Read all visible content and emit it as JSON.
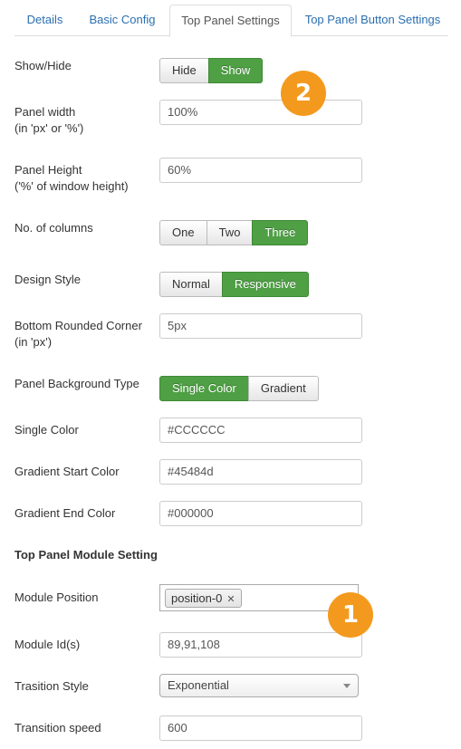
{
  "tabs": [
    {
      "label": "Details"
    },
    {
      "label": "Basic Config"
    },
    {
      "label": "Top Panel Settings",
      "active": true
    },
    {
      "label": "Top Panel Button Settings"
    }
  ],
  "fields": {
    "show_hide": {
      "label": "Show/Hide",
      "options": [
        "Hide",
        "Show"
      ],
      "selected": "Show"
    },
    "panel_width": {
      "label": "Panel width",
      "sublabel": "(in 'px' or '%')",
      "value": "100%"
    },
    "panel_height": {
      "label": "Panel Height",
      "sublabel": "('%' of window height)",
      "value": "60%"
    },
    "columns": {
      "label": "No. of columns",
      "options": [
        "One",
        "Two",
        "Three"
      ],
      "selected": "Three"
    },
    "design_style": {
      "label": "Design Style",
      "options": [
        "Normal",
        "Responsive"
      ],
      "selected": "Responsive"
    },
    "bottom_corner": {
      "label": "Bottom Rounded Corner",
      "sublabel": "(in 'px')",
      "value": "5px"
    },
    "bg_type": {
      "label": "Panel Background Type",
      "options": [
        "Single Color",
        "Gradient"
      ],
      "selected": "Single Color"
    },
    "single_color": {
      "label": "Single Color",
      "value": "#CCCCCC"
    },
    "gradient_start": {
      "label": "Gradient Start Color",
      "value": "#45484d"
    },
    "gradient_end": {
      "label": "Gradient End Color",
      "value": "#000000"
    }
  },
  "module_section": {
    "title": "Top Panel Module Setting",
    "position": {
      "label": "Module Position",
      "chip": "position-0",
      "remove_glyph": "✕"
    },
    "module_ids": {
      "label": "Module Id(s)",
      "value": "89,91,108"
    },
    "transition_style": {
      "label": "Trasition Style",
      "value": "Exponential"
    },
    "transition_speed": {
      "label": "Transition speed",
      "value": "600"
    }
  },
  "callouts": {
    "one": "1",
    "two": "2",
    "color": "#f39a1e"
  },
  "colors": {
    "accent_green": "#4f9f45",
    "tab_link": "#2a6fb0"
  }
}
